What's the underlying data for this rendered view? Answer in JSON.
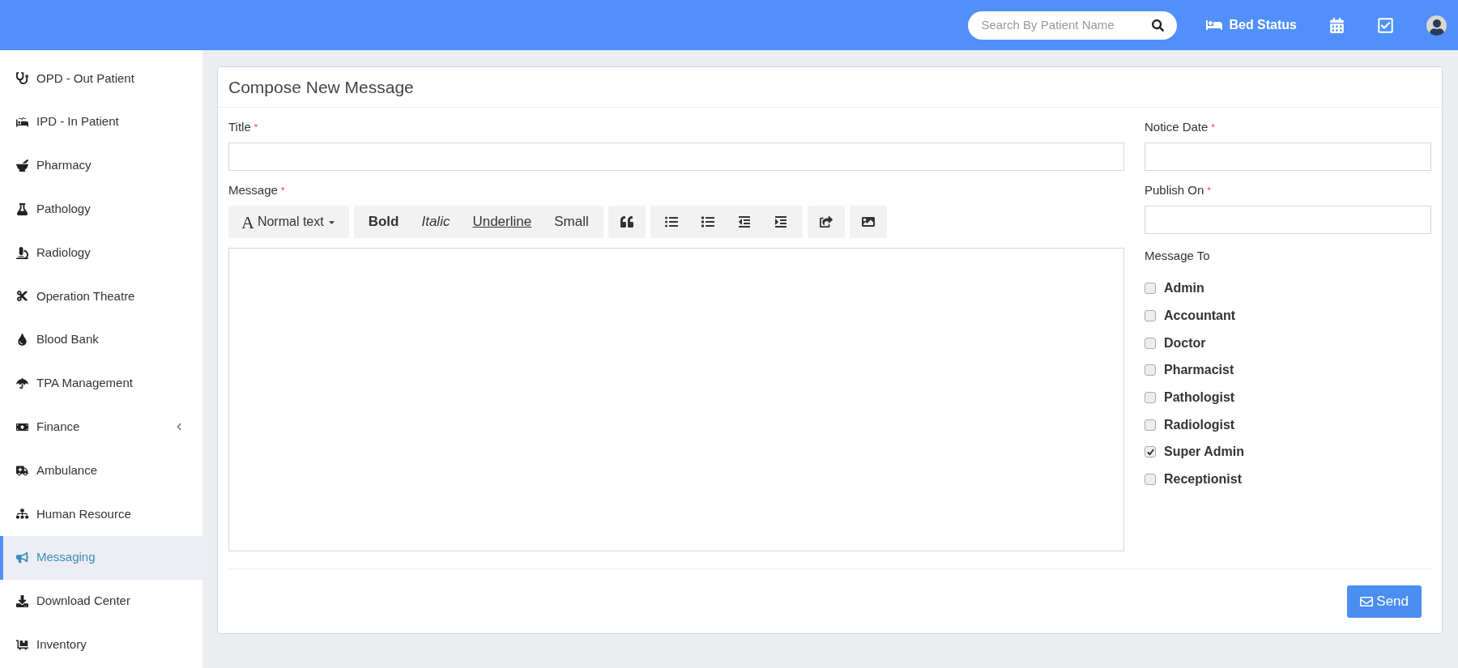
{
  "header": {
    "search": {
      "placeholder": "Search By Patient Name"
    },
    "bed_status": "Bed Status"
  },
  "sidebar": {
    "items": [
      {
        "label": "OPD - Out Patient",
        "selected": false,
        "has_submenu": false
      },
      {
        "label": "IPD - In Patient",
        "selected": false,
        "has_submenu": false
      },
      {
        "label": "Pharmacy",
        "selected": false,
        "has_submenu": false
      },
      {
        "label": "Pathology",
        "selected": false,
        "has_submenu": false
      },
      {
        "label": "Radiology",
        "selected": false,
        "has_submenu": false
      },
      {
        "label": "Operation Theatre",
        "selected": false,
        "has_submenu": false
      },
      {
        "label": "Blood Bank",
        "selected": false,
        "has_submenu": false
      },
      {
        "label": "TPA Management",
        "selected": false,
        "has_submenu": false
      },
      {
        "label": "Finance",
        "selected": false,
        "has_submenu": true
      },
      {
        "label": "Ambulance",
        "selected": false,
        "has_submenu": false
      },
      {
        "label": "Human Resource",
        "selected": false,
        "has_submenu": false
      },
      {
        "label": "Messaging",
        "selected": true,
        "has_submenu": false
      },
      {
        "label": "Download Center",
        "selected": false,
        "has_submenu": false
      },
      {
        "label": "Inventory",
        "selected": false,
        "has_submenu": false
      }
    ]
  },
  "panel": {
    "title": "Compose New Message",
    "title_field": {
      "label": "Title",
      "marker": "*"
    },
    "message_field": {
      "label": "Message",
      "marker": "*"
    },
    "toolbar": {
      "format_glyph": "A",
      "format": "Normal text",
      "styles": [
        {
          "label": "Bold",
          "kind": "bold"
        },
        {
          "label": "Italic",
          "kind": "italic"
        },
        {
          "label": "Underline",
          "kind": "underline"
        },
        {
          "label": "Small",
          "kind": "plain"
        }
      ]
    },
    "notice_date": {
      "label": "Notice Date",
      "marker": "*"
    },
    "publish_on": {
      "label": "Publish On",
      "marker": "*"
    },
    "message_to": {
      "label": "Message To",
      "options": [
        {
          "label": "Admin",
          "checked": false
        },
        {
          "label": "Accountant",
          "checked": false
        },
        {
          "label": "Doctor",
          "checked": false
        },
        {
          "label": "Pharmacist",
          "checked": false
        },
        {
          "label": "Pathologist",
          "checked": false
        },
        {
          "label": "Radiologist",
          "checked": false
        },
        {
          "label": "Super Admin",
          "checked": true
        },
        {
          "label": "Receptionist",
          "checked": false
        }
      ]
    },
    "send_button": "Send"
  }
}
